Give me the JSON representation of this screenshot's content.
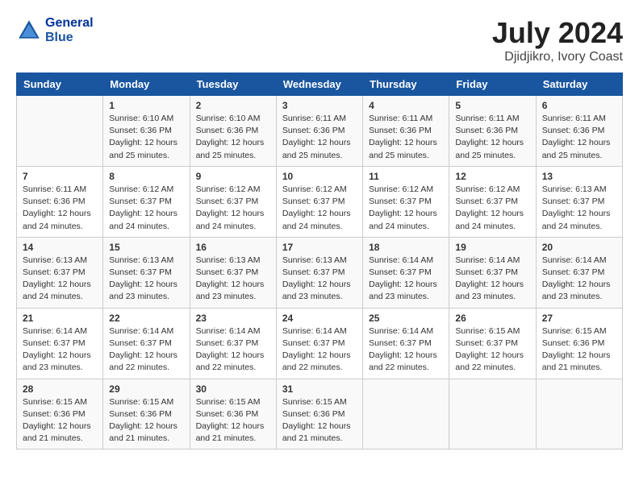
{
  "header": {
    "logo_line1": "General",
    "logo_line2": "Blue",
    "month": "July 2024",
    "location": "Djidjikro, Ivory Coast"
  },
  "weekdays": [
    "Sunday",
    "Monday",
    "Tuesday",
    "Wednesday",
    "Thursday",
    "Friday",
    "Saturday"
  ],
  "weeks": [
    [
      {
        "day": "",
        "info": ""
      },
      {
        "day": "1",
        "info": "Sunrise: 6:10 AM\nSunset: 6:36 PM\nDaylight: 12 hours\nand 25 minutes."
      },
      {
        "day": "2",
        "info": "Sunrise: 6:10 AM\nSunset: 6:36 PM\nDaylight: 12 hours\nand 25 minutes."
      },
      {
        "day": "3",
        "info": "Sunrise: 6:11 AM\nSunset: 6:36 PM\nDaylight: 12 hours\nand 25 minutes."
      },
      {
        "day": "4",
        "info": "Sunrise: 6:11 AM\nSunset: 6:36 PM\nDaylight: 12 hours\nand 25 minutes."
      },
      {
        "day": "5",
        "info": "Sunrise: 6:11 AM\nSunset: 6:36 PM\nDaylight: 12 hours\nand 25 minutes."
      },
      {
        "day": "6",
        "info": "Sunrise: 6:11 AM\nSunset: 6:36 PM\nDaylight: 12 hours\nand 25 minutes."
      }
    ],
    [
      {
        "day": "7",
        "info": "Sunrise: 6:11 AM\nSunset: 6:36 PM\nDaylight: 12 hours\nand 24 minutes."
      },
      {
        "day": "8",
        "info": "Sunrise: 6:12 AM\nSunset: 6:37 PM\nDaylight: 12 hours\nand 24 minutes."
      },
      {
        "day": "9",
        "info": "Sunrise: 6:12 AM\nSunset: 6:37 PM\nDaylight: 12 hours\nand 24 minutes."
      },
      {
        "day": "10",
        "info": "Sunrise: 6:12 AM\nSunset: 6:37 PM\nDaylight: 12 hours\nand 24 minutes."
      },
      {
        "day": "11",
        "info": "Sunrise: 6:12 AM\nSunset: 6:37 PM\nDaylight: 12 hours\nand 24 minutes."
      },
      {
        "day": "12",
        "info": "Sunrise: 6:12 AM\nSunset: 6:37 PM\nDaylight: 12 hours\nand 24 minutes."
      },
      {
        "day": "13",
        "info": "Sunrise: 6:13 AM\nSunset: 6:37 PM\nDaylight: 12 hours\nand 24 minutes."
      }
    ],
    [
      {
        "day": "14",
        "info": "Sunrise: 6:13 AM\nSunset: 6:37 PM\nDaylight: 12 hours\nand 24 minutes."
      },
      {
        "day": "15",
        "info": "Sunrise: 6:13 AM\nSunset: 6:37 PM\nDaylight: 12 hours\nand 23 minutes."
      },
      {
        "day": "16",
        "info": "Sunrise: 6:13 AM\nSunset: 6:37 PM\nDaylight: 12 hours\nand 23 minutes."
      },
      {
        "day": "17",
        "info": "Sunrise: 6:13 AM\nSunset: 6:37 PM\nDaylight: 12 hours\nand 23 minutes."
      },
      {
        "day": "18",
        "info": "Sunrise: 6:14 AM\nSunset: 6:37 PM\nDaylight: 12 hours\nand 23 minutes."
      },
      {
        "day": "19",
        "info": "Sunrise: 6:14 AM\nSunset: 6:37 PM\nDaylight: 12 hours\nand 23 minutes."
      },
      {
        "day": "20",
        "info": "Sunrise: 6:14 AM\nSunset: 6:37 PM\nDaylight: 12 hours\nand 23 minutes."
      }
    ],
    [
      {
        "day": "21",
        "info": "Sunrise: 6:14 AM\nSunset: 6:37 PM\nDaylight: 12 hours\nand 23 minutes."
      },
      {
        "day": "22",
        "info": "Sunrise: 6:14 AM\nSunset: 6:37 PM\nDaylight: 12 hours\nand 22 minutes."
      },
      {
        "day": "23",
        "info": "Sunrise: 6:14 AM\nSunset: 6:37 PM\nDaylight: 12 hours\nand 22 minutes."
      },
      {
        "day": "24",
        "info": "Sunrise: 6:14 AM\nSunset: 6:37 PM\nDaylight: 12 hours\nand 22 minutes."
      },
      {
        "day": "25",
        "info": "Sunrise: 6:14 AM\nSunset: 6:37 PM\nDaylight: 12 hours\nand 22 minutes."
      },
      {
        "day": "26",
        "info": "Sunrise: 6:15 AM\nSunset: 6:37 PM\nDaylight: 12 hours\nand 22 minutes."
      },
      {
        "day": "27",
        "info": "Sunrise: 6:15 AM\nSunset: 6:36 PM\nDaylight: 12 hours\nand 21 minutes."
      }
    ],
    [
      {
        "day": "28",
        "info": "Sunrise: 6:15 AM\nSunset: 6:36 PM\nDaylight: 12 hours\nand 21 minutes."
      },
      {
        "day": "29",
        "info": "Sunrise: 6:15 AM\nSunset: 6:36 PM\nDaylight: 12 hours\nand 21 minutes."
      },
      {
        "day": "30",
        "info": "Sunrise: 6:15 AM\nSunset: 6:36 PM\nDaylight: 12 hours\nand 21 minutes."
      },
      {
        "day": "31",
        "info": "Sunrise: 6:15 AM\nSunset: 6:36 PM\nDaylight: 12 hours\nand 21 minutes."
      },
      {
        "day": "",
        "info": ""
      },
      {
        "day": "",
        "info": ""
      },
      {
        "day": "",
        "info": ""
      }
    ]
  ]
}
